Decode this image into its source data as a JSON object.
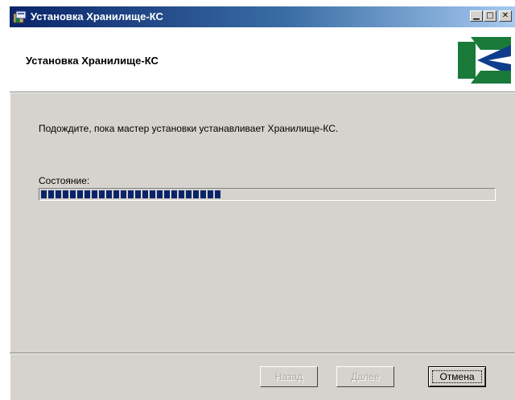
{
  "window": {
    "title": "Установка Хранилище-КС",
    "controls": [
      "minimize",
      "maximize",
      "close"
    ]
  },
  "header": {
    "title": "Установка Хранилище-КС",
    "logo": "kc-logo",
    "logo_colors": {
      "green": "#1a7a3a",
      "blue": "#0f3d8c"
    }
  },
  "body": {
    "message": "Подождите, пока мастер установки устанавливает Хранилище-КС.",
    "status_label": "Состояние:",
    "progress_percent": 40
  },
  "buttons": {
    "back": {
      "label": "Назад",
      "enabled": false
    },
    "next": {
      "label": "Далее",
      "enabled": false
    },
    "cancel": {
      "label": "Отмена",
      "enabled": true,
      "default": true
    }
  },
  "colors": {
    "titlebar_start": "#0a246a",
    "titlebar_end": "#a6caf0",
    "progress_fill": "#0a246a",
    "face": "#d6d3ce"
  }
}
